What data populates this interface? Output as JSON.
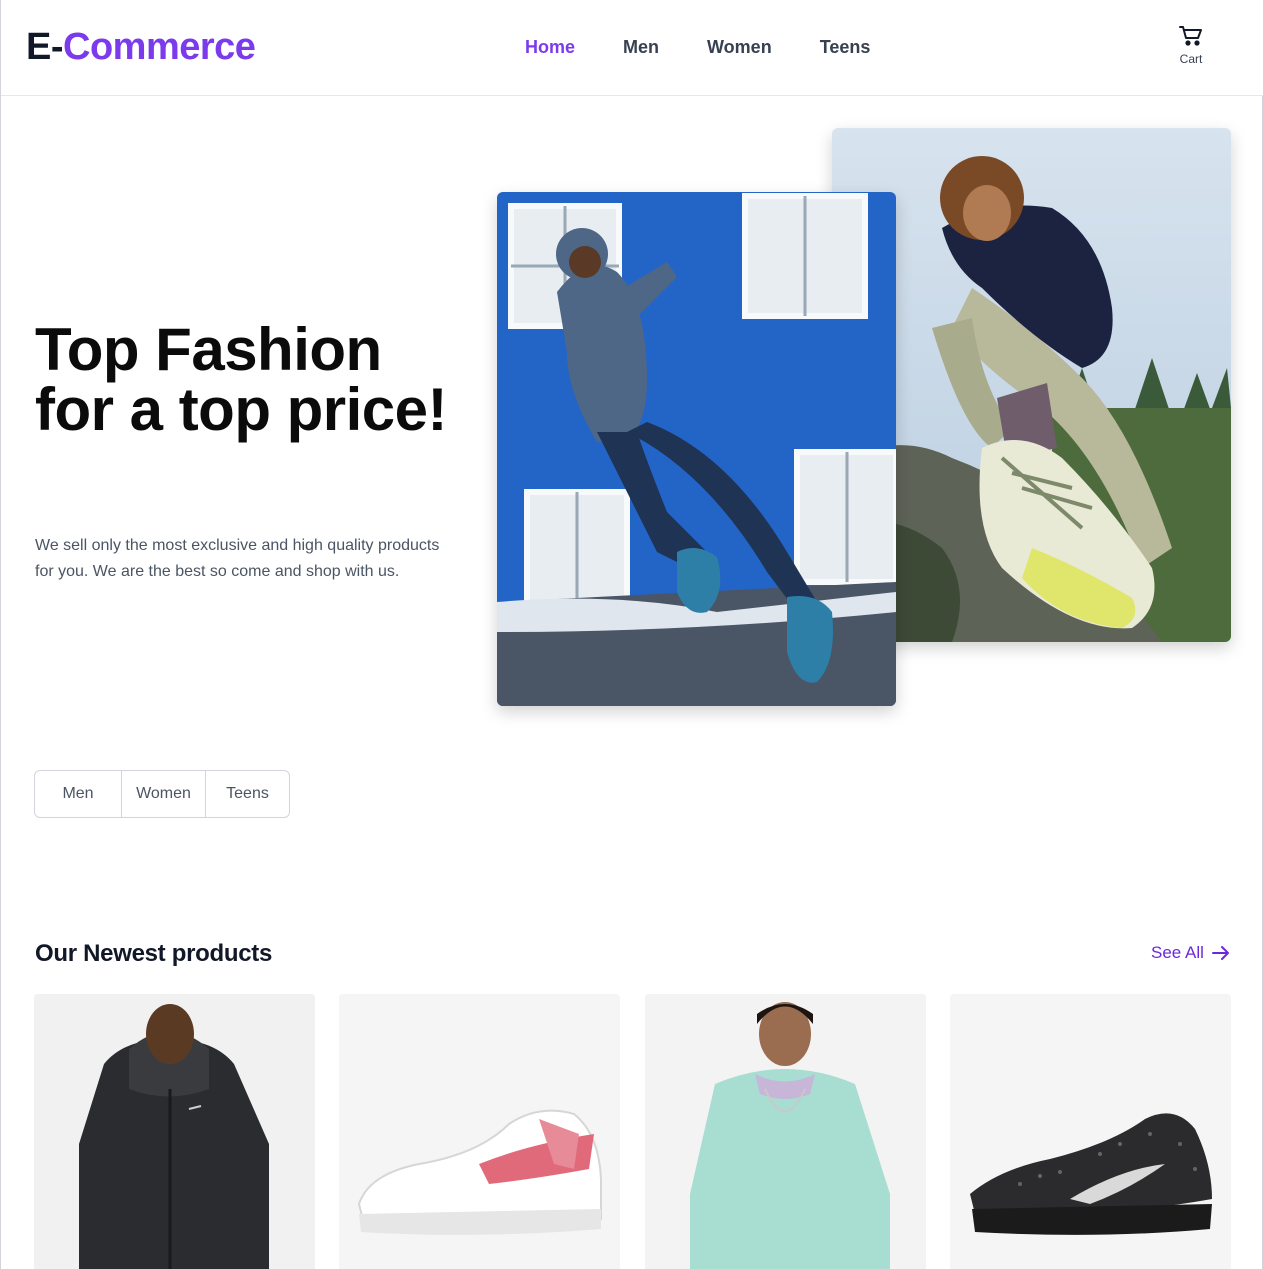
{
  "header": {
    "logo_prefix": "E-",
    "logo_main": "Commerce",
    "nav": [
      "Home",
      "Men",
      "Women",
      "Teens"
    ],
    "active_nav": "Home",
    "cart_label": "Cart"
  },
  "hero": {
    "title": "Top Fashion for a top price!",
    "text": "We sell only the most exclusive and high quality products for you. We are the best so come and shop with us.",
    "images": [
      "runner-photo",
      "hiker-sneaker-photo"
    ]
  },
  "categories": [
    "Men",
    "Women",
    "Teens"
  ],
  "products_section": {
    "title": "Our Newest products",
    "see_all": "See All",
    "products": [
      "black-jacket",
      "white-red-sneaker",
      "mint-sweatshirt",
      "black-runner-sneaker"
    ]
  },
  "colors": {
    "accent": "#7c3aed",
    "text": "#111827",
    "muted": "#4b5563"
  }
}
